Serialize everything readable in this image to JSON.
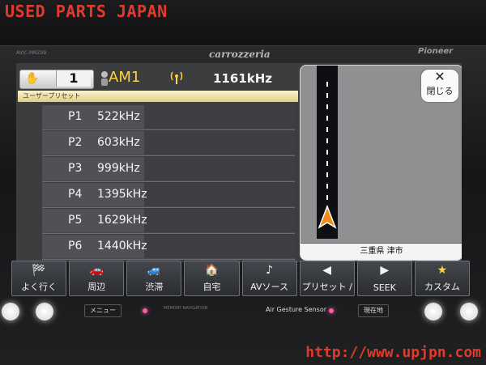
{
  "watermark": {
    "top": "USED PARTS JAPAN",
    "bottom": "http://www.upjpn.com"
  },
  "device": {
    "brand": "carrozzeria",
    "maker": "Pioneer",
    "model": "AVIC-MRZ99"
  },
  "header": {
    "volume": "1",
    "source": "AM1",
    "frequency": "1161kHz",
    "preset_tab": "ユーザープリセット"
  },
  "presets": [
    {
      "key": "P1",
      "freq": "522kHz"
    },
    {
      "key": "P2",
      "freq": "603kHz"
    },
    {
      "key": "P3",
      "freq": "999kHz"
    },
    {
      "key": "P4",
      "freq": "1395kHz"
    },
    {
      "key": "P5",
      "freq": "1629kHz"
    },
    {
      "key": "P6",
      "freq": "1440kHz"
    }
  ],
  "map": {
    "close_label": "閉じる",
    "place": "三重県 津市"
  },
  "toolbar": [
    {
      "label": "よく行く",
      "icon": "flags-icon"
    },
    {
      "label": "周辺",
      "icon": "car-icon"
    },
    {
      "label": "渋滞",
      "icon": "traffic-icon"
    },
    {
      "label": "自宅",
      "icon": "home-icon"
    },
    {
      "label": "AVソース",
      "icon": "music-note-icon"
    },
    {
      "label": "プリセット /",
      "icon": "left-arrow-icon"
    },
    {
      "label": "SEEK",
      "icon": "right-arrow-icon"
    },
    {
      "label": "カスタム",
      "icon": "star-icon"
    }
  ],
  "hardware": {
    "menu": "メニュー",
    "nav_label": "MEMORY NAVIGATION",
    "sensor_label": "Air Gesture Sensor",
    "current_location": "現在地"
  },
  "colors": {
    "watermark": "#e23a2c",
    "source_text": "#ffd53a",
    "led": "#ff59a6"
  }
}
